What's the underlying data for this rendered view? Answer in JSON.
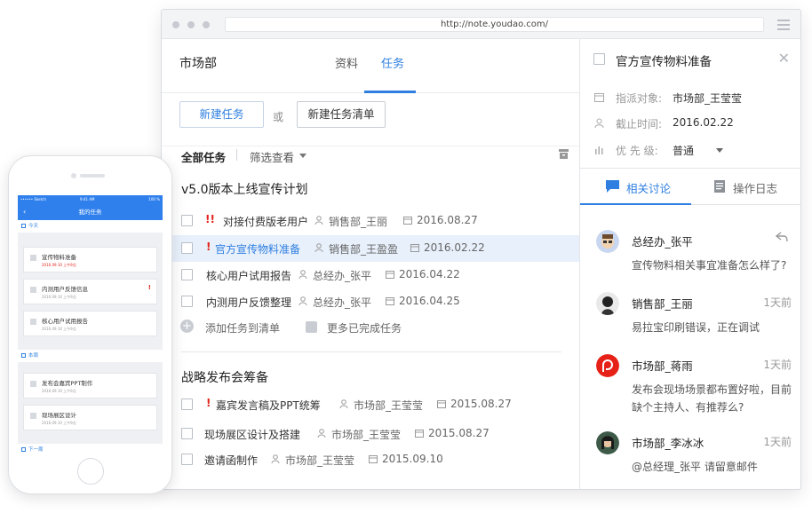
{
  "browser": {
    "url": "http://note.youdao.com/"
  },
  "main": {
    "department": "市场部",
    "tabs": [
      {
        "label": "资料"
      },
      {
        "label": "任务"
      }
    ],
    "buttons": {
      "new_task": "新建任务",
      "or": "或",
      "new_task_list": "新建任务清单"
    },
    "filter": {
      "all_tasks": "全部任务",
      "filter_view": "筛选查看"
    },
    "groups": [
      {
        "title": "v5.0版本上线宣传计划",
        "tasks": [
          {
            "priority": "!!",
            "title": "对接付费版老用户",
            "assignee": "销售部_王丽",
            "date": "2016.08.27"
          },
          {
            "priority": "!",
            "title": "官方宣传物料准备",
            "assignee": "销售部_王盈盈",
            "date": "2016.02.22"
          },
          {
            "priority": "",
            "title": "核心用户试用报告",
            "assignee": "总经办_张平",
            "date": "2016.04.22"
          },
          {
            "priority": "",
            "title": "内测用户反馈整理",
            "assignee": "总经办_张平",
            "date": "2016.04.25"
          }
        ],
        "add_task": "添加任务到清单",
        "more_done": "更多已完成任务"
      },
      {
        "title": "战略发布会筹备",
        "tasks": [
          {
            "priority": "!",
            "title": "嘉宾发言稿及PPT统筹",
            "assignee": "市场部_王莹莹",
            "date": "2015.08.27"
          },
          {
            "priority": "",
            "title": "现场展区设计及搭建",
            "assignee": "市场部_王莹莹",
            "date": "2015.08.27"
          },
          {
            "priority": "",
            "title": "邀请函制作",
            "assignee": "市场部_王莹莹",
            "date": "2015.09.10"
          }
        ]
      }
    ]
  },
  "detail": {
    "title": "官方宣传物料准备",
    "fields": [
      {
        "label": "指派对象:",
        "value": "市场部_王莹莹"
      },
      {
        "label": "截止时间:",
        "value": "2016.02.22"
      },
      {
        "label": "优 先 级:",
        "value": "普通"
      }
    ],
    "tabs": [
      {
        "label": "相关讨论"
      },
      {
        "label": "操作日志"
      }
    ],
    "comments": [
      {
        "name": "总经办_张平",
        "time": "",
        "body": "宣传物料相关事宜准备怎么样了?"
      },
      {
        "name": "销售部_王丽",
        "time": "1天前",
        "body": "易拉宝印刷错误，正在调试"
      },
      {
        "name": "市场部_蒋雨",
        "time": "1天前",
        "body": "发布会现场场景都布置好啦，目前缺个主持人、有推荐么?"
      },
      {
        "name": "市场部_李冰冰",
        "time": "1天前",
        "body": "@总经理_张平  请留意邮件"
      }
    ]
  },
  "phone": {
    "status_carrier": "•••••• Sketch",
    "status_time": "9:41 AM",
    "status_battery": "100 %",
    "nav_title": "我的任务",
    "sections": [
      {
        "label": "今天"
      },
      {
        "label": "本周"
      },
      {
        "label": "下一周"
      }
    ],
    "cards": [
      {
        "title": "宣传物料准备",
        "meta": "2016.09.10  上午9点",
        "urgent": false,
        "red": true
      },
      {
        "title": "内测用户反馈信息",
        "meta": "2016.09.10  上午9点",
        "urgent": true,
        "red": false
      },
      {
        "title": "核心用户试用报告",
        "meta": "2016.09.10  上午9点",
        "urgent": false,
        "red": false
      },
      {
        "title": "发布会嘉宾PPT制作",
        "meta": "2016.09.10  上午9点",
        "urgent": false,
        "red": false
      },
      {
        "title": "现场展区设计",
        "meta": "2016.09.10  上午9点",
        "urgent": false,
        "red": false
      }
    ]
  },
  "colors": {
    "accent": "#2f7fe0",
    "urgent": "#e2231a"
  }
}
